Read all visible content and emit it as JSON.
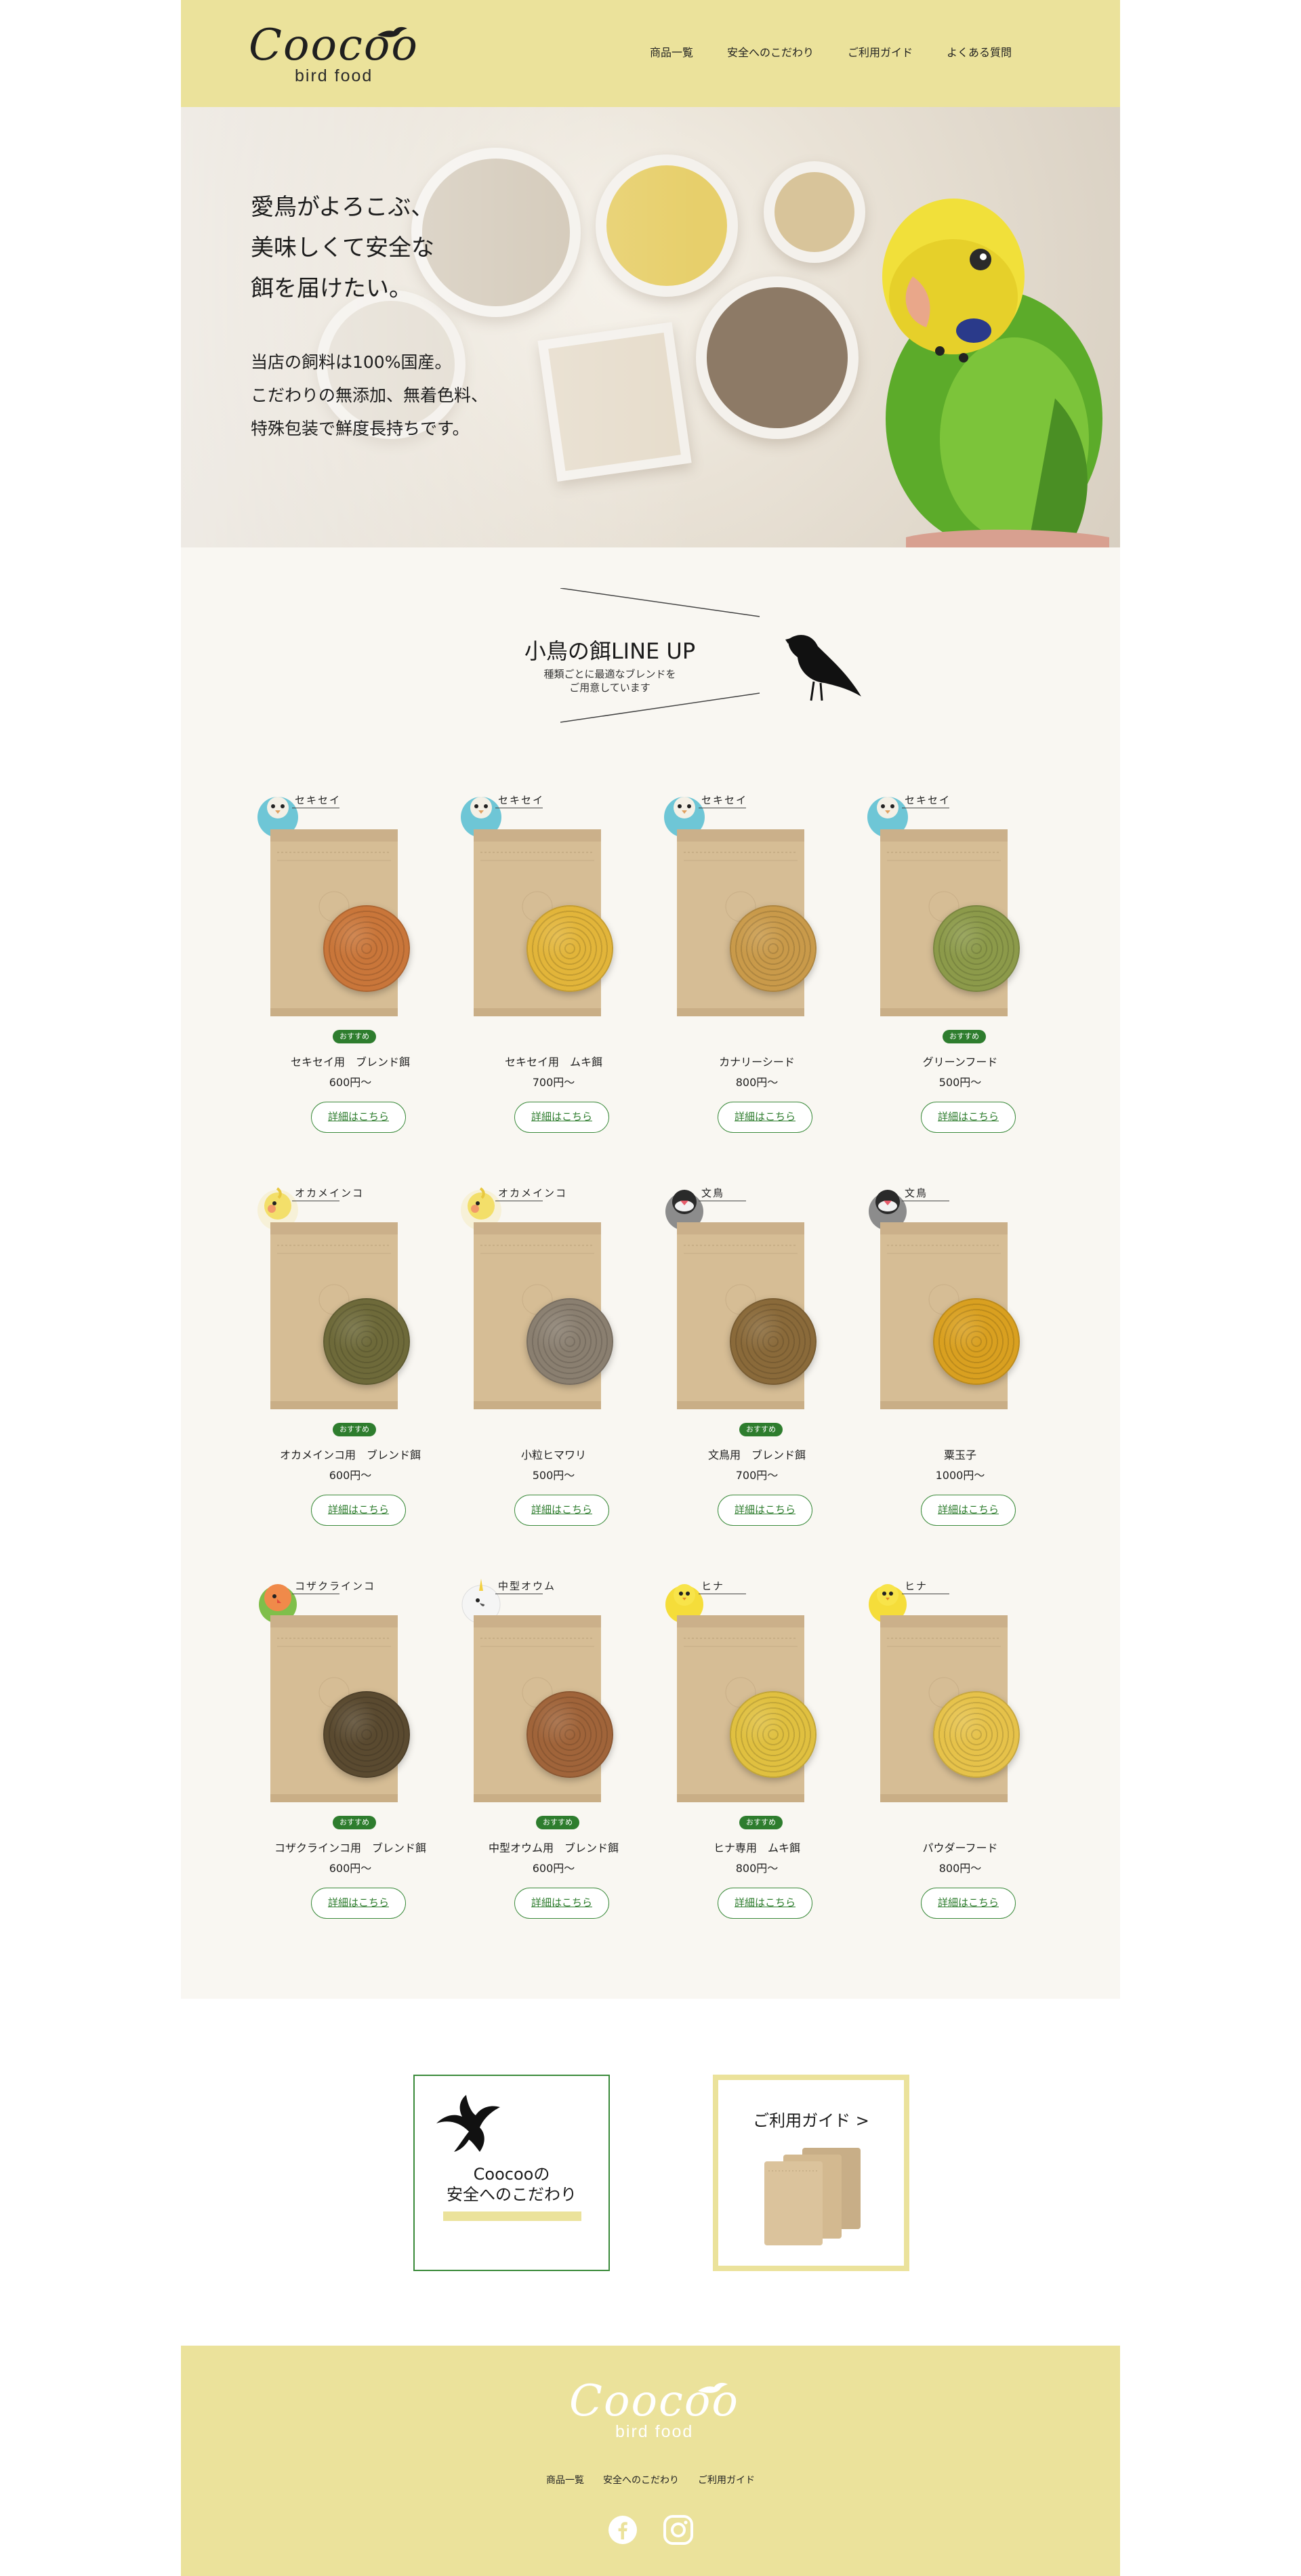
{
  "brand": {
    "script": "Coocoo",
    "sub": "bird food"
  },
  "nav": [
    "商品一覧",
    "安全へのこだわり",
    "ご利用ガイド",
    "よくある質問"
  ],
  "hero": {
    "catch": "愛鳥がよろこぶ、\n美味しくて安全な\n餌を届けたい。",
    "body": "当店の飼料は100%国産。\nこだわりの無添加、無着色料、\n特殊包装で鮮度長持ちです。"
  },
  "lineup": {
    "title": "小鳥の餌LINE UP",
    "subtitle": "種類ごとに最適なブレンドを\nご用意しています",
    "recommend_label": "おすすめ",
    "detail_label": "詳細はこちら",
    "products": [
      {
        "bird": "セキセイ",
        "avatar": "budgie-blue-icon",
        "name": "セキセイ用　ブレンド餌",
        "price": "600円〜",
        "recommended": true,
        "seed": "#c9763a"
      },
      {
        "bird": "セキセイ",
        "avatar": "budgie-blue-icon",
        "name": "セキセイ用　ムキ餌",
        "price": "700円〜",
        "recommended": false,
        "seed": "#e2b53a"
      },
      {
        "bird": "セキセイ",
        "avatar": "budgie-blue-icon",
        "name": "カナリーシード",
        "price": "800円〜",
        "recommended": false,
        "seed": "#c99a4a"
      },
      {
        "bird": "セキセイ",
        "avatar": "budgie-blue-icon",
        "name": "グリーンフード",
        "price": "500円〜",
        "recommended": true,
        "seed": "#8c9a4a"
      },
      {
        "bird": "オカメインコ",
        "avatar": "cockatiel-icon",
        "name": "オカメインコ用　ブレンド餌",
        "price": "600円〜",
        "recommended": true,
        "seed": "#6e6a3a"
      },
      {
        "bird": "オカメインコ",
        "avatar": "cockatiel-icon",
        "name": "小粒ヒマワリ",
        "price": "500円〜",
        "recommended": false,
        "seed": "#8a7f70"
      },
      {
        "bird": "文鳥",
        "avatar": "java-sparrow-icon",
        "name": "文鳥用　ブレンド餌",
        "price": "700円〜",
        "recommended": true,
        "seed": "#8a6a3a"
      },
      {
        "bird": "文鳥",
        "avatar": "java-sparrow-icon",
        "name": "粟玉子",
        "price": "1000円〜",
        "recommended": false,
        "seed": "#d9a020"
      },
      {
        "bird": "コザクラインコ",
        "avatar": "lovebird-icon",
        "name": "コザクラインコ用　ブレンド餌",
        "price": "600円〜",
        "recommended": true,
        "seed": "#5a4a30"
      },
      {
        "bird": "中型オウム",
        "avatar": "cockatoo-icon",
        "name": "中型オウム用　ブレンド餌",
        "price": "600円〜",
        "recommended": true,
        "seed": "#a0643a"
      },
      {
        "bird": "ヒナ",
        "avatar": "chick-icon",
        "name": "ヒナ専用　ムキ餌",
        "price": "800円〜",
        "recommended": true,
        "seed": "#e0c040"
      },
      {
        "bird": "ヒナ",
        "avatar": "chick-icon",
        "name": "パウダーフード",
        "price": "800円〜",
        "recommended": false,
        "seed": "#e6c24a"
      }
    ]
  },
  "features": {
    "safety": "Coocooの\n安全へのこだわり",
    "guide": "ご利用ガイド >"
  },
  "footer": {
    "nav": [
      "商品一覧",
      "安全へのこだわり",
      "ご利用ガイド"
    ],
    "social": [
      "facebook-icon",
      "instagram-icon"
    ]
  },
  "colors": {
    "brand_yellow": "#ebe29b",
    "accent_green": "#2e7d2e",
    "cream": "#f9f7f2"
  }
}
